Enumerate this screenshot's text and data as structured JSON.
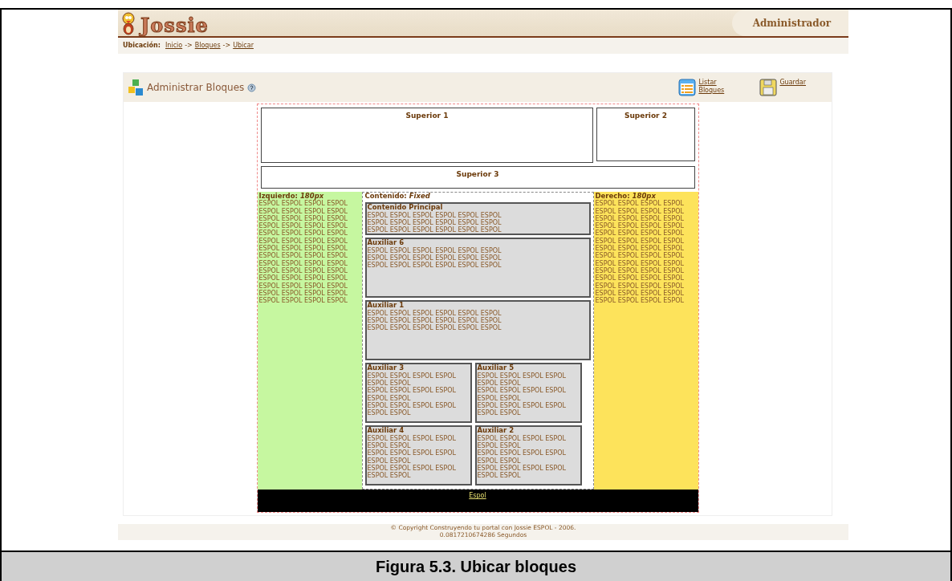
{
  "header": {
    "logo": "Jossie",
    "role": "Administrador"
  },
  "breadcrumb": {
    "label": "Ubicación:",
    "items": [
      {
        "kind": "link",
        "text": "Inicio"
      },
      {
        "kind": "separator",
        "text": "->"
      },
      {
        "kind": "link",
        "text": "Bloques"
      },
      {
        "kind": "separator",
        "text": "->"
      },
      {
        "kind": "link",
        "text": "Ubicar"
      }
    ]
  },
  "panel": {
    "title": "Administrar Bloques",
    "actions": [
      {
        "kind": "list",
        "label": "Listar Bloques"
      },
      {
        "kind": "save",
        "label": "Guardar"
      }
    ]
  },
  "layout": {
    "top": [
      {
        "title": "Superior 1"
      },
      {
        "title": "Superior 2"
      }
    ],
    "top_wide": {
      "title": "Superior 3"
    },
    "left": {
      "title": "Izquierdo: *180px*",
      "lines": [
        "ESPOL ESPOL ESPOL ESPOL",
        "ESPOL ESPOL ESPOL ESPOL",
        "ESPOL ESPOL ESPOL ESPOL",
        "ESPOL ESPOL ESPOL ESPOL",
        "ESPOL ESPOL ESPOL ESPOL",
        "ESPOL ESPOL ESPOL ESPOL",
        "ESPOL ESPOL ESPOL ESPOL",
        "ESPOL ESPOL ESPOL ESPOL",
        "ESPOL ESPOL ESPOL ESPOL",
        "ESPOL ESPOL ESPOL ESPOL",
        "ESPOL ESPOL ESPOL ESPOL",
        "ESPOL ESPOL ESPOL ESPOL",
        "ESPOL ESPOL ESPOL ESPOL",
        "ESPOL ESPOL ESPOL ESPOL"
      ]
    },
    "center": {
      "title": "Contenido: *Fixed*",
      "rows": [
        [
          {
            "kind": "main",
            "title": "Contenido Principal",
            "lines": [
              "ESPOL ESPOL ESPOL ESPOL ESPOL ESPOL",
              "ESPOL ESPOL ESPOL ESPOL ESPOL ESPOL",
              "ESPOL ESPOL ESPOL ESPOL ESPOL ESPOL"
            ]
          }
        ],
        [
          {
            "kind": "aux",
            "title": "Auxiliar 6",
            "lines": [
              "ESPOL ESPOL ESPOL ESPOL ESPOL ESPOL",
              "ESPOL ESPOL ESPOL ESPOL ESPOL ESPOL",
              "ESPOL ESPOL ESPOL ESPOL ESPOL ESPOL"
            ]
          }
        ],
        [
          {
            "kind": "aux",
            "title": "Auxiliar 1",
            "lines": [
              "ESPOL ESPOL ESPOL ESPOL ESPOL ESPOL",
              "ESPOL ESPOL ESPOL ESPOL ESPOL ESPOL",
              "ESPOL ESPOL ESPOL ESPOL ESPOL ESPOL"
            ]
          }
        ],
        [
          {
            "kind": "aux",
            "title": "Auxiliar 3",
            "lines": [
              "ESPOL ESPOL ESPOL ESPOL ESPOL ESPOL",
              "ESPOL ESPOL ESPOL ESPOL ESPOL ESPOL",
              "ESPOL ESPOL ESPOL ESPOL ESPOL ESPOL"
            ]
          },
          {
            "kind": "aux",
            "title": "Auxiliar 5",
            "lines": [
              "ESPOL ESPOL ESPOL ESPOL ESPOL ESPOL",
              "ESPOL ESPOL ESPOL ESPOL ESPOL ESPOL",
              "ESPOL ESPOL ESPOL ESPOL ESPOL ESPOL"
            ]
          }
        ],
        [
          {
            "kind": "aux",
            "title": "Auxiliar 4",
            "lines": [
              "ESPOL ESPOL ESPOL ESPOL ESPOL ESPOL",
              "ESPOL ESPOL ESPOL ESPOL ESPOL ESPOL",
              "ESPOL ESPOL ESPOL ESPOL ESPOL ESPOL"
            ]
          },
          {
            "kind": "aux",
            "title": "Auxiliar 2",
            "lines": [
              "ESPOL ESPOL ESPOL ESPOL ESPOL ESPOL",
              "ESPOL ESPOL ESPOL ESPOL ESPOL ESPOL",
              "ESPOL ESPOL ESPOL ESPOL ESPOL ESPOL"
            ]
          }
        ]
      ]
    },
    "right": {
      "title": "Derecho: *180px*",
      "lines": [
        "ESPOL ESPOL ESPOL ESPOL",
        "ESPOL ESPOL ESPOL ESPOL",
        "ESPOL ESPOL ESPOL ESPOL",
        "ESPOL ESPOL ESPOL ESPOL",
        "ESPOL ESPOL ESPOL ESPOL",
        "ESPOL ESPOL ESPOL ESPOL",
        "ESPOL ESPOL ESPOL ESPOL",
        "ESPOL ESPOL ESPOL ESPOL",
        "ESPOL ESPOL ESPOL ESPOL",
        "ESPOL ESPOL ESPOL ESPOL",
        "ESPOL ESPOL ESPOL ESPOL",
        "ESPOL ESPOL ESPOL ESPOL",
        "ESPOL ESPOL ESPOL ESPOL",
        "ESPOL ESPOL ESPOL ESPOL"
      ]
    },
    "footer": {
      "link": "Espol"
    }
  },
  "copyright": [
    "© Copyright Construyendo tu portal con Jossie ESPOL - 2006.",
    "0.0817210674286 Segundos"
  ],
  "caption": "Figura 5.3. Ubicar bloques"
}
